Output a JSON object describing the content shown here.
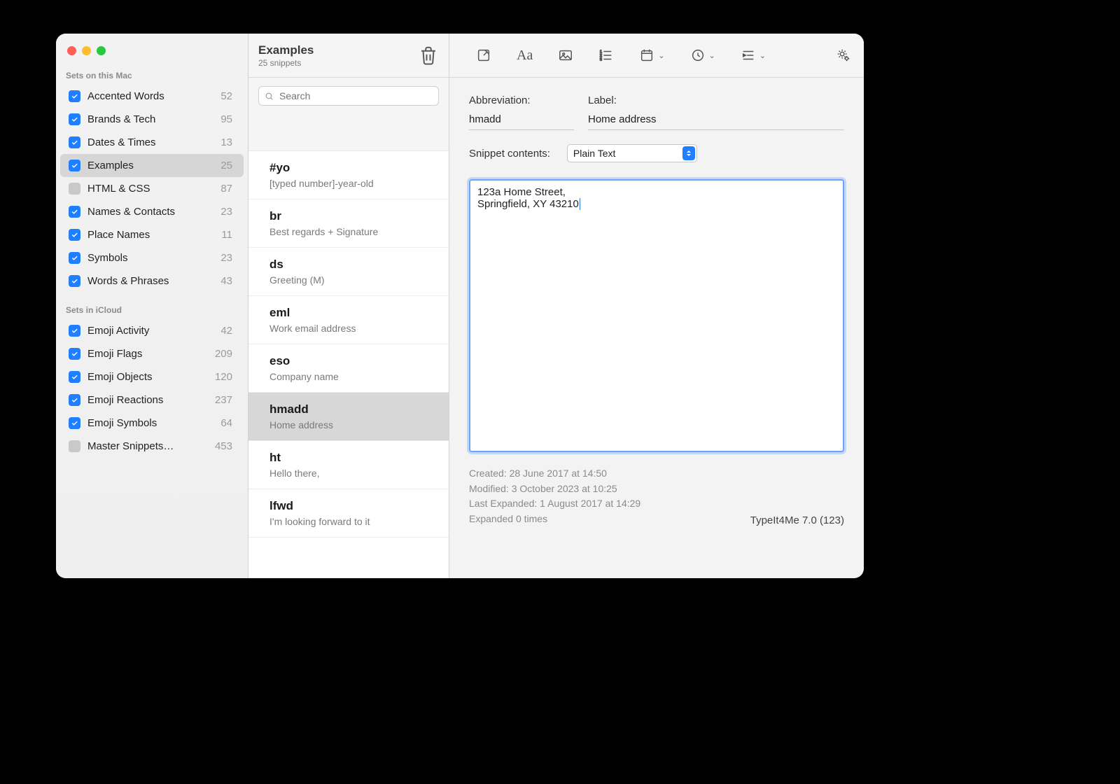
{
  "sidebar": {
    "section1_title": "Sets on this Mac",
    "section2_title": "Sets in iCloud",
    "mac_sets": [
      {
        "name": "Accented Words",
        "count": "52",
        "checked": true,
        "selected": false
      },
      {
        "name": "Brands & Tech",
        "count": "95",
        "checked": true,
        "selected": false
      },
      {
        "name": "Dates & Times",
        "count": "13",
        "checked": true,
        "selected": false
      },
      {
        "name": "Examples",
        "count": "25",
        "checked": true,
        "selected": true
      },
      {
        "name": "HTML & CSS",
        "count": "87",
        "checked": false,
        "selected": false
      },
      {
        "name": "Names & Contacts",
        "count": "23",
        "checked": true,
        "selected": false
      },
      {
        "name": "Place Names",
        "count": "11",
        "checked": true,
        "selected": false
      },
      {
        "name": "Symbols",
        "count": "23",
        "checked": true,
        "selected": false
      },
      {
        "name": "Words & Phrases",
        "count": "43",
        "checked": true,
        "selected": false
      }
    ],
    "icloud_sets": [
      {
        "name": "Emoji Activity",
        "count": "42",
        "checked": true,
        "selected": false
      },
      {
        "name": "Emoji Flags",
        "count": "209",
        "checked": true,
        "selected": false
      },
      {
        "name": "Emoji Objects",
        "count": "120",
        "checked": true,
        "selected": false
      },
      {
        "name": "Emoji Reactions",
        "count": "237",
        "checked": true,
        "selected": false
      },
      {
        "name": "Emoji Symbols",
        "count": "64",
        "checked": true,
        "selected": false
      },
      {
        "name": "Master Snippets…",
        "count": "453",
        "checked": false,
        "selected": false
      }
    ]
  },
  "middle": {
    "title": "Examples",
    "subtitle": "25 snippets",
    "search_placeholder": "Search",
    "snippets": [
      {
        "abbr": "#yo",
        "desc": "[typed number]-year-old",
        "selected": false
      },
      {
        "abbr": "br",
        "desc": "Best regards + Signature",
        "selected": false
      },
      {
        "abbr": "ds",
        "desc": "Greeting (M)",
        "selected": false
      },
      {
        "abbr": "eml",
        "desc": "Work email address",
        "selected": false
      },
      {
        "abbr": "eso",
        "desc": "Company name",
        "selected": false
      },
      {
        "abbr": "hmadd",
        "desc": "Home address",
        "selected": true
      },
      {
        "abbr": "ht",
        "desc": "Hello there,",
        "selected": false
      },
      {
        "abbr": "lfwd",
        "desc": "I'm looking forward to it",
        "selected": false
      }
    ]
  },
  "detail": {
    "abbr_label": "Abbreviation:",
    "abbr_value": "hmadd",
    "label_label": "Label:",
    "label_value": "Home address",
    "contents_label": "Snippet contents:",
    "type_value": "Plain Text",
    "content": "123a Home Street,\nSpringfield, XY 43210",
    "meta": {
      "created": "Created: 28 June 2017 at 14:50",
      "modified": "Modified: 3 October 2023 at 10:25",
      "last_expanded": "Last Expanded: 1 August 2017 at 14:29",
      "expanded_count": "Expanded 0 times"
    },
    "app_version": "TypeIt4Me 7.0 (123)"
  }
}
